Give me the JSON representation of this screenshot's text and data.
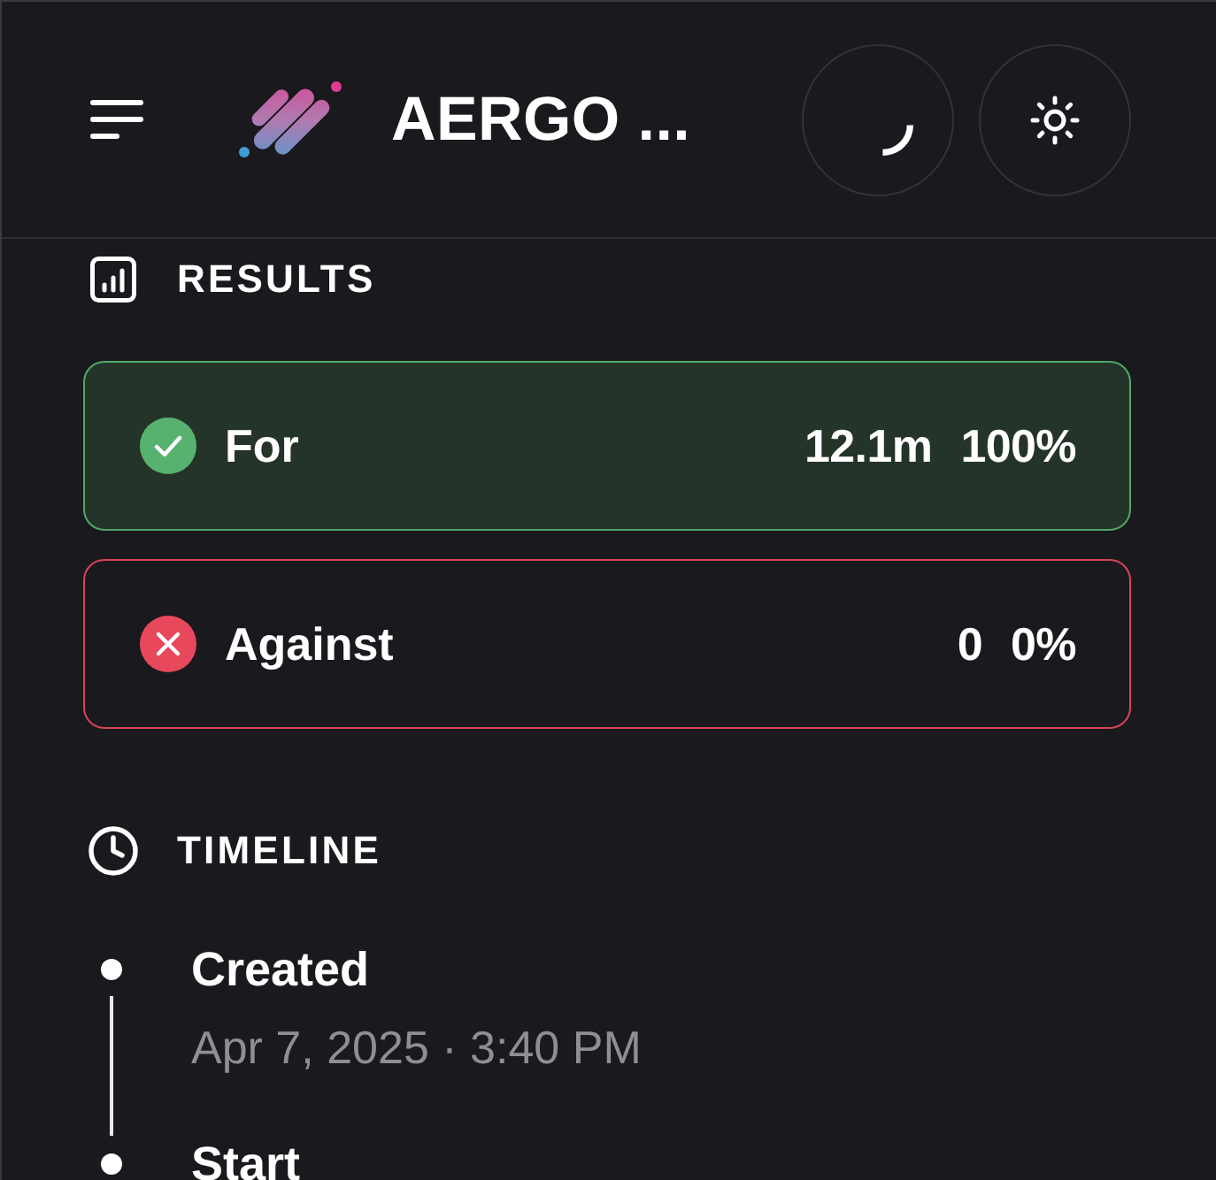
{
  "header": {
    "title": "AERGO ..."
  },
  "results": {
    "title": "RESULTS",
    "options": [
      {
        "kind": "for",
        "label": "For",
        "votes": "12.1m",
        "percent": "100%"
      },
      {
        "kind": "against",
        "label": "Against",
        "votes": "0",
        "percent": "0%"
      }
    ]
  },
  "timeline": {
    "title": "TIMELINE",
    "events": [
      {
        "title": "Created",
        "time": "Apr 7, 2025 · 3:40 PM"
      },
      {
        "title": "Start"
      }
    ]
  }
}
